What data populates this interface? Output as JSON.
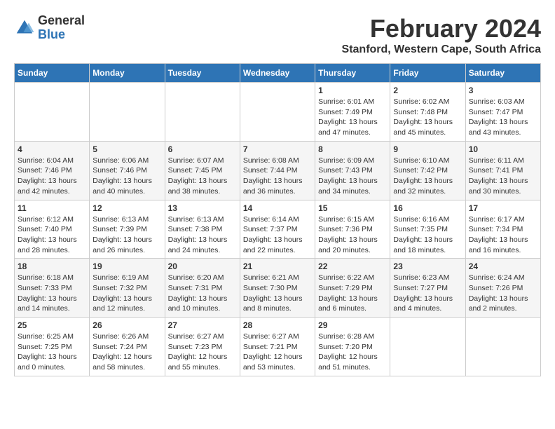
{
  "header": {
    "logo_general": "General",
    "logo_blue": "Blue",
    "month_title": "February 2024",
    "location": "Stanford, Western Cape, South Africa"
  },
  "days_of_week": [
    "Sunday",
    "Monday",
    "Tuesday",
    "Wednesday",
    "Thursday",
    "Friday",
    "Saturday"
  ],
  "weeks": [
    [
      {
        "day": "",
        "info": ""
      },
      {
        "day": "",
        "info": ""
      },
      {
        "day": "",
        "info": ""
      },
      {
        "day": "",
        "info": ""
      },
      {
        "day": "1",
        "info": "Sunrise: 6:01 AM\nSunset: 7:49 PM\nDaylight: 13 hours and 47 minutes."
      },
      {
        "day": "2",
        "info": "Sunrise: 6:02 AM\nSunset: 7:48 PM\nDaylight: 13 hours and 45 minutes."
      },
      {
        "day": "3",
        "info": "Sunrise: 6:03 AM\nSunset: 7:47 PM\nDaylight: 13 hours and 43 minutes."
      }
    ],
    [
      {
        "day": "4",
        "info": "Sunrise: 6:04 AM\nSunset: 7:46 PM\nDaylight: 13 hours and 42 minutes."
      },
      {
        "day": "5",
        "info": "Sunrise: 6:06 AM\nSunset: 7:46 PM\nDaylight: 13 hours and 40 minutes."
      },
      {
        "day": "6",
        "info": "Sunrise: 6:07 AM\nSunset: 7:45 PM\nDaylight: 13 hours and 38 minutes."
      },
      {
        "day": "7",
        "info": "Sunrise: 6:08 AM\nSunset: 7:44 PM\nDaylight: 13 hours and 36 minutes."
      },
      {
        "day": "8",
        "info": "Sunrise: 6:09 AM\nSunset: 7:43 PM\nDaylight: 13 hours and 34 minutes."
      },
      {
        "day": "9",
        "info": "Sunrise: 6:10 AM\nSunset: 7:42 PM\nDaylight: 13 hours and 32 minutes."
      },
      {
        "day": "10",
        "info": "Sunrise: 6:11 AM\nSunset: 7:41 PM\nDaylight: 13 hours and 30 minutes."
      }
    ],
    [
      {
        "day": "11",
        "info": "Sunrise: 6:12 AM\nSunset: 7:40 PM\nDaylight: 13 hours and 28 minutes."
      },
      {
        "day": "12",
        "info": "Sunrise: 6:13 AM\nSunset: 7:39 PM\nDaylight: 13 hours and 26 minutes."
      },
      {
        "day": "13",
        "info": "Sunrise: 6:13 AM\nSunset: 7:38 PM\nDaylight: 13 hours and 24 minutes."
      },
      {
        "day": "14",
        "info": "Sunrise: 6:14 AM\nSunset: 7:37 PM\nDaylight: 13 hours and 22 minutes."
      },
      {
        "day": "15",
        "info": "Sunrise: 6:15 AM\nSunset: 7:36 PM\nDaylight: 13 hours and 20 minutes."
      },
      {
        "day": "16",
        "info": "Sunrise: 6:16 AM\nSunset: 7:35 PM\nDaylight: 13 hours and 18 minutes."
      },
      {
        "day": "17",
        "info": "Sunrise: 6:17 AM\nSunset: 7:34 PM\nDaylight: 13 hours and 16 minutes."
      }
    ],
    [
      {
        "day": "18",
        "info": "Sunrise: 6:18 AM\nSunset: 7:33 PM\nDaylight: 13 hours and 14 minutes."
      },
      {
        "day": "19",
        "info": "Sunrise: 6:19 AM\nSunset: 7:32 PM\nDaylight: 13 hours and 12 minutes."
      },
      {
        "day": "20",
        "info": "Sunrise: 6:20 AM\nSunset: 7:31 PM\nDaylight: 13 hours and 10 minutes."
      },
      {
        "day": "21",
        "info": "Sunrise: 6:21 AM\nSunset: 7:30 PM\nDaylight: 13 hours and 8 minutes."
      },
      {
        "day": "22",
        "info": "Sunrise: 6:22 AM\nSunset: 7:29 PM\nDaylight: 13 hours and 6 minutes."
      },
      {
        "day": "23",
        "info": "Sunrise: 6:23 AM\nSunset: 7:27 PM\nDaylight: 13 hours and 4 minutes."
      },
      {
        "day": "24",
        "info": "Sunrise: 6:24 AM\nSunset: 7:26 PM\nDaylight: 13 hours and 2 minutes."
      }
    ],
    [
      {
        "day": "25",
        "info": "Sunrise: 6:25 AM\nSunset: 7:25 PM\nDaylight: 13 hours and 0 minutes."
      },
      {
        "day": "26",
        "info": "Sunrise: 6:26 AM\nSunset: 7:24 PM\nDaylight: 12 hours and 58 minutes."
      },
      {
        "day": "27",
        "info": "Sunrise: 6:27 AM\nSunset: 7:23 PM\nDaylight: 12 hours and 55 minutes."
      },
      {
        "day": "28",
        "info": "Sunrise: 6:27 AM\nSunset: 7:21 PM\nDaylight: 12 hours and 53 minutes."
      },
      {
        "day": "29",
        "info": "Sunrise: 6:28 AM\nSunset: 7:20 PM\nDaylight: 12 hours and 51 minutes."
      },
      {
        "day": "",
        "info": ""
      },
      {
        "day": "",
        "info": ""
      }
    ]
  ]
}
